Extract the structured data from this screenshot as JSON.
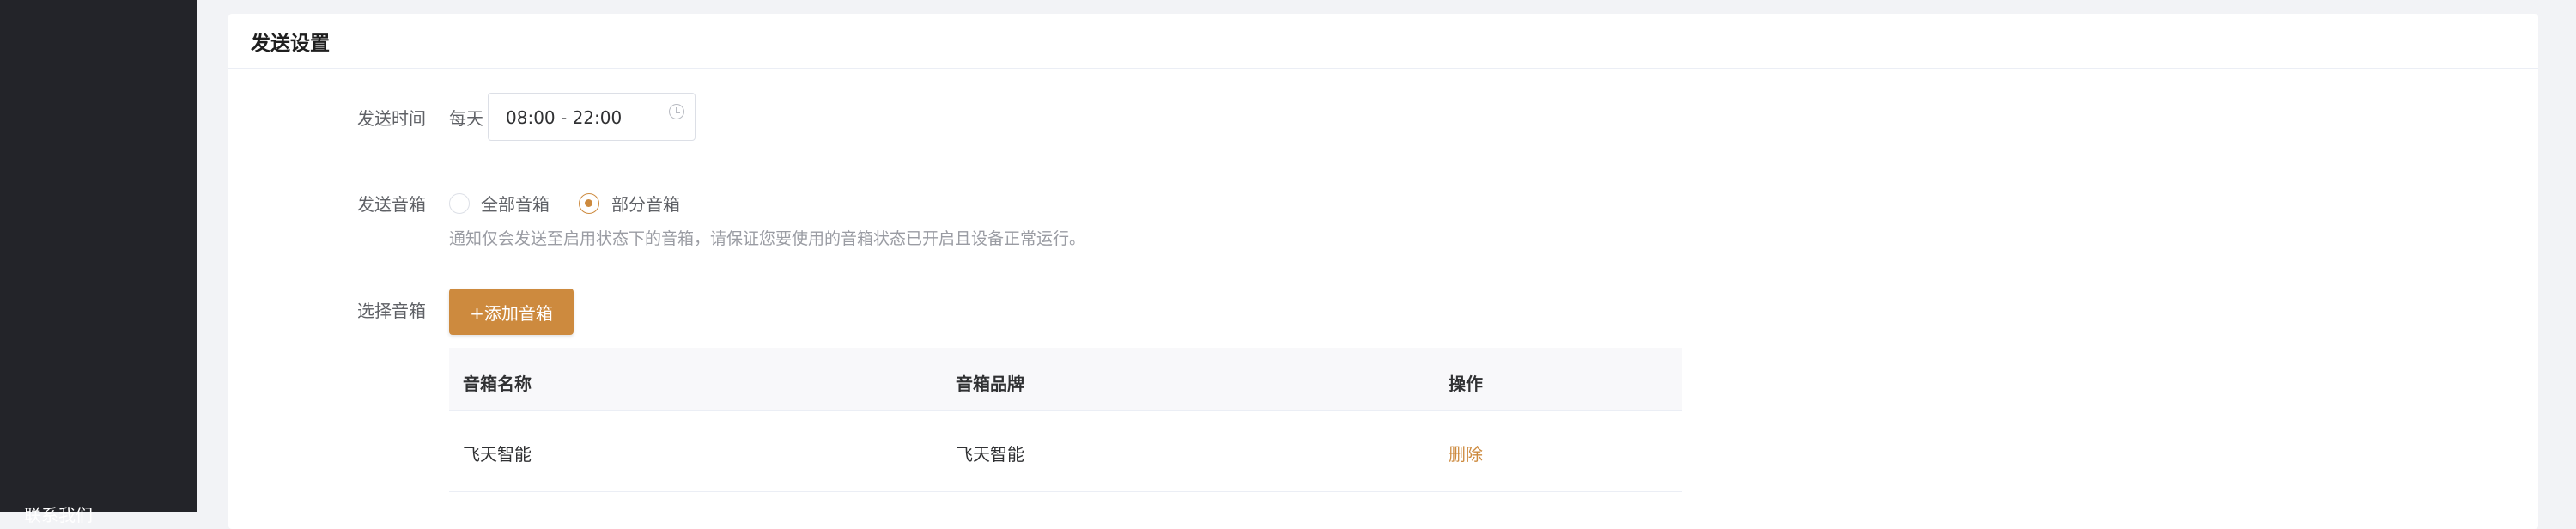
{
  "sidebar": {
    "footer_link": "联系我们"
  },
  "panel": {
    "title": "发送设置"
  },
  "send_time": {
    "label": "发送时间",
    "prefix": "每天",
    "value": "08:00 - 22:00",
    "icon": "clock-icon"
  },
  "send_speaker": {
    "label": "发送音箱",
    "options": [
      "全部音箱",
      "部分音箱"
    ],
    "selected": "部分音箱",
    "hint": "通知仅会发送至启用状态下的音箱，请保证您要使用的音箱状态已开启且设备正常运行。"
  },
  "select_speaker": {
    "label": "选择音箱",
    "add_button": "+添加音箱"
  },
  "speaker_table": {
    "columns": [
      "音箱名称",
      "音箱品牌",
      "操作"
    ],
    "rows": [
      {
        "name": "飞天智能",
        "brand": "飞天智能",
        "action": "删除"
      }
    ]
  },
  "colors": {
    "accent": "#cd8a3e",
    "sidebar_bg": "#232429",
    "page_bg": "#f2f3f6"
  }
}
